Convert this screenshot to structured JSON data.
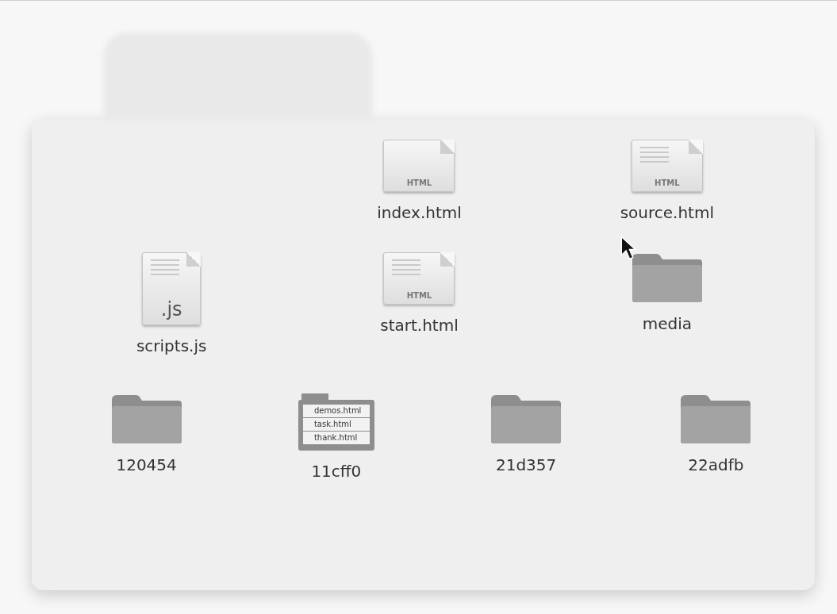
{
  "upper_items": [
    {
      "kind": "html",
      "name": "index.html",
      "badge": "HTML",
      "lines": false
    },
    {
      "kind": "html",
      "name": "source.html",
      "badge": "HTML",
      "lines": true
    },
    {
      "kind": "js",
      "name": "scripts.js",
      "badge": ".js",
      "lines": true
    },
    {
      "kind": "html",
      "name": "start.html",
      "badge": "HTML",
      "lines": true
    },
    {
      "kind": "folder",
      "name": "media"
    }
  ],
  "lower_items": [
    {
      "kind": "folder",
      "name": "120454"
    },
    {
      "kind": "preview",
      "name": "11cff0",
      "files": [
        "demos.html",
        "task.html",
        "thank.html"
      ]
    },
    {
      "kind": "folder",
      "name": "21d357"
    },
    {
      "kind": "folder",
      "name": "22adfb"
    }
  ]
}
